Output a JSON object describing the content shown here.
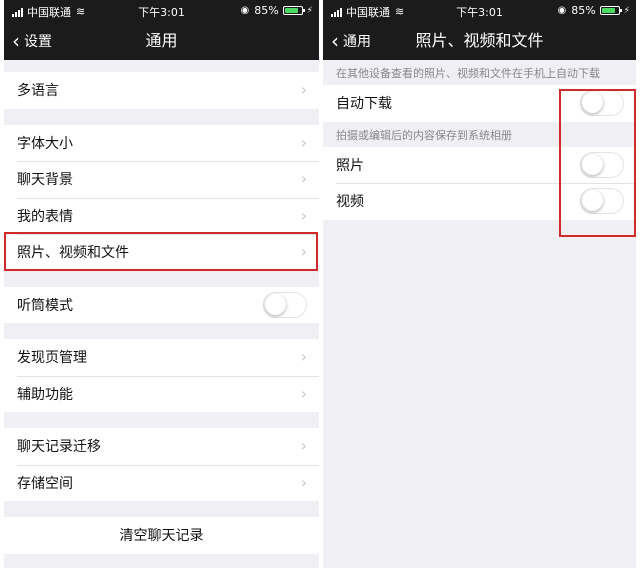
{
  "status_bar": {
    "carrier": "中国联通",
    "time": "下午3:01",
    "battery": "85%",
    "battery_level": 0.85
  },
  "left": {
    "nav": {
      "back_label": "设置",
      "title": "通用"
    },
    "items": {
      "language": "多语言",
      "font_size": "字体大小",
      "chat_background": "聊天背景",
      "my_stickers": "我的表情",
      "photos_videos_files": "照片、视频和文件",
      "earpiece_mode": "听筒模式",
      "discover_management": "发现页管理",
      "accessibility": "辅助功能",
      "chat_history_migration": "聊天记录迁移",
      "storage": "存储空间",
      "clear_chat_history": "清空聊天记录"
    },
    "toggles": {
      "earpiece_mode": false
    }
  },
  "right": {
    "nav": {
      "back_label": "通用",
      "title": "照片、视频和文件"
    },
    "section1_header": "在其他设备查看的照片、视频和文件在手机上自动下载",
    "section2_header": "拍摄或编辑后的内容保存到系统相册",
    "items": {
      "auto_download": "自动下载",
      "photos": "照片",
      "videos": "视频"
    },
    "toggles": {
      "auto_download": false,
      "photos": false,
      "videos": false
    }
  },
  "colors": {
    "nav_background": "#1b1b1b",
    "page_background": "#efeff4",
    "highlight": "#d02a2a",
    "battery_fill": "#4cd964"
  },
  "icons": [
    "signal-icon",
    "wifi-icon",
    "orientation-lock-icon",
    "battery-icon",
    "charging-icon",
    "back-chevron-icon",
    "chevron-right-icon"
  ]
}
